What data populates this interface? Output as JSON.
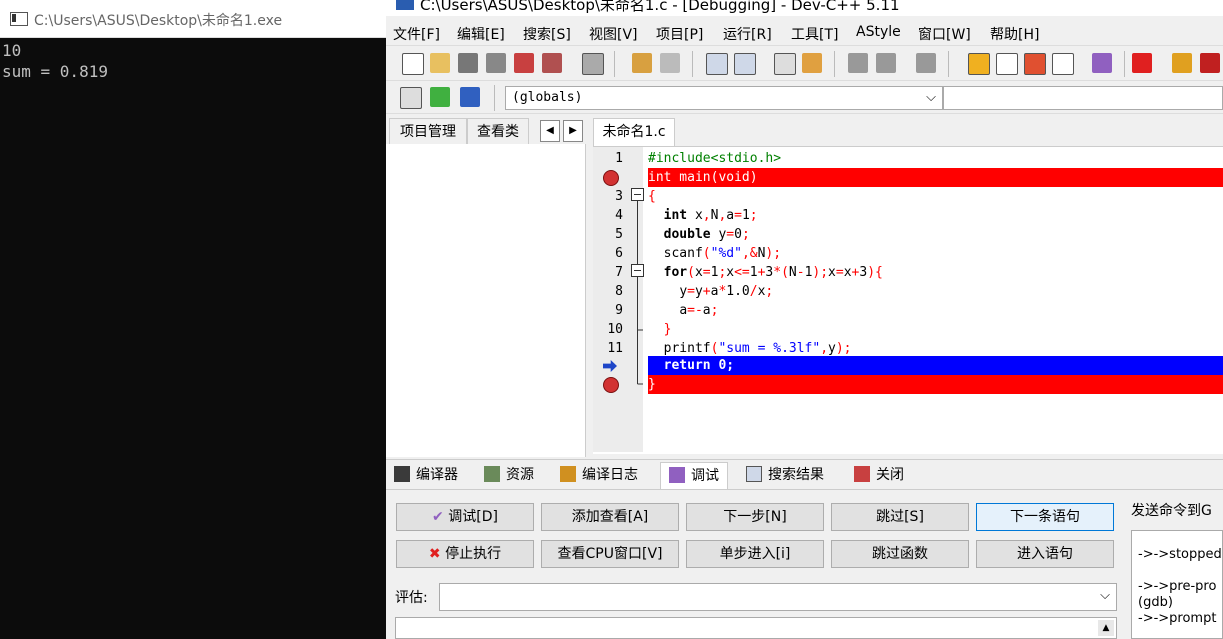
{
  "console": {
    "title": "C:\\Users\\ASUS\\Desktop\\未命名1.exe",
    "output": [
      "10",
      "sum = 0.819"
    ]
  },
  "ide": {
    "title": "C:\\Users\\ASUS\\Desktop\\未命名1.c - [Debugging] - Dev-C++ 5.11",
    "menu": [
      "文件[F]",
      "编辑[E]",
      "搜索[S]",
      "视图[V]",
      "项目[P]",
      "运行[R]",
      "工具[T]",
      "AStyle",
      "窗口[W]",
      "帮助[H]"
    ],
    "globals_combo": "(globals)",
    "left_tabs": [
      "项目管理",
      "查看类"
    ],
    "editor_tab": "未命名1.c",
    "code": {
      "line_numbers": [
        "1",
        "",
        "3",
        "4",
        "5",
        "6",
        "7",
        "8",
        "9",
        "10",
        "11",
        "",
        ""
      ],
      "l1": "#include<stdio.h>",
      "l2": "int main(void)",
      "l3": "{",
      "l4a": "int",
      "l4b": " x",
      "l4c": ",",
      "l4d": "N",
      "l4e": ",",
      "l4f": "a",
      "l4g": "=",
      "l4h": "1",
      "l4i": ";",
      "l5a": "double",
      "l5b": " y",
      "l5c": "=",
      "l5d": "0",
      "l5e": ";",
      "l6a": "scanf",
      "l6b": "(",
      "l6c": "\"%d\"",
      "l6d": ",&",
      "l6e": "N",
      "l6f": ");",
      "l7a": "for",
      "l7b": "(",
      "l7c": "x",
      "l7d": "=",
      "l7e": "1",
      "l7f": ";",
      "l7g": "x",
      "l7h": "<=",
      "l7i": "1",
      "l7j": "+",
      "l7k": "3",
      "l7l": "*(",
      "l7m": "N",
      "l7n": "-",
      "l7o": "1",
      "l7p": ");",
      "l7q": "x",
      "l7r": "=",
      "l7s": "x",
      "l7t": "+",
      "l7u": "3",
      "l7v": "){",
      "l8a": "y",
      "l8b": "=",
      "l8c": "y",
      "l8d": "+",
      "l8e": "a",
      "l8f": "*",
      "l8g": "1.0",
      "l8h": "/",
      "l8i": "x",
      "l8j": ";",
      "l9a": "a",
      "l9b": "=-",
      "l9c": "a",
      "l9d": ";",
      "l10": "}",
      "l11a": "printf",
      "l11b": "(",
      "l11c": "\"sum = %.3lf\"",
      "l11d": ",",
      "l11e": "y",
      "l11f": ");",
      "l12": "return 0;",
      "l13": "}"
    },
    "bottom_tabs": [
      "编译器",
      "资源",
      "编译日志",
      "调试",
      "搜索结果",
      "关闭"
    ],
    "debug": {
      "buttons_row1": [
        "调试[D]",
        "添加查看[A]",
        "下一步[N]",
        "跳过[S]",
        "下一条语句"
      ],
      "buttons_row2": [
        "停止执行",
        "查看CPU窗口[V]",
        "单步进入[i]",
        "跳过函数",
        "进入语句"
      ],
      "eval_label": "评估:",
      "gdb_label": "发送命令到G",
      "gdb_output": [
        "->->stopped",
        "",
        "->->pre-pro",
        "(gdb)",
        "->->prompt"
      ]
    }
  },
  "colors": {
    "breakpoint_line": "#ff0000",
    "current_line": "#0000ff",
    "accent": "#0078d7"
  }
}
